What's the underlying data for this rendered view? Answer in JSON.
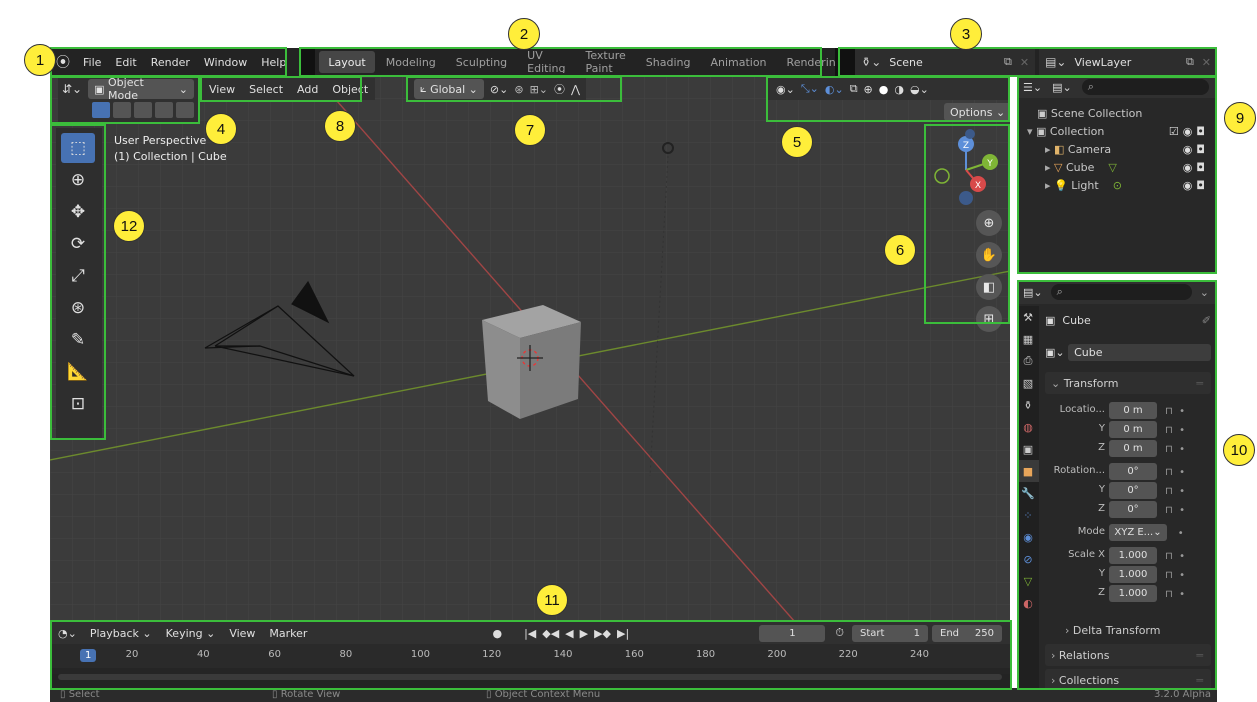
{
  "topbar": {
    "menus": [
      "File",
      "Edit",
      "Render",
      "Window",
      "Help"
    ],
    "workspaces": [
      "Layout",
      "Modeling",
      "Sculpting",
      "UV Editing",
      "Texture Paint",
      "Shading",
      "Animation",
      "Rendering"
    ],
    "active_workspace": "Layout",
    "scene": "Scene",
    "view_layer": "ViewLayer"
  },
  "viewport_header": {
    "mode": "Object Mode",
    "menus": [
      "View",
      "Select",
      "Add",
      "Object"
    ],
    "orientation": "Global",
    "options": "Options"
  },
  "viewport": {
    "view_name": "User Perspective",
    "context": "(1) Collection | Cube",
    "gizmo": {
      "z": "Z",
      "y": "Y",
      "x": "X"
    }
  },
  "outliner": {
    "root": "Scene Collection",
    "collection": "Collection",
    "items": [
      {
        "name": "Camera",
        "icon": "camera-icon",
        "color": "#e0b36a"
      },
      {
        "name": "Cube",
        "icon": "mesh-icon",
        "color": "#e8a55a"
      },
      {
        "name": "Light",
        "icon": "light-icon",
        "color": "#e0b36a"
      }
    ]
  },
  "properties": {
    "object_name": "Cube",
    "mesh_name": "Cube",
    "transform_label": "Transform",
    "location_label": "Locatio...",
    "rotation_label": "Rotation...",
    "axis_y": "Y",
    "axis_z": "Z",
    "location": [
      "0 m",
      "0 m",
      "0 m"
    ],
    "rotation": [
      "0°",
      "0°",
      "0°"
    ],
    "mode_label": "Mode",
    "mode_value": "XYZ E...",
    "scale_x_label": "Scale X",
    "scale": [
      "1.000",
      "1.000",
      "1.000"
    ],
    "delta_transform": "Delta Transform",
    "relations": "Relations",
    "collections": "Collections"
  },
  "timeline": {
    "menus": [
      "Playback",
      "Keying",
      "View",
      "Marker"
    ],
    "current_frame": "1",
    "start_label": "Start",
    "start": "1",
    "end_label": "End",
    "end": "250",
    "ruler": [
      "1",
      "20",
      "40",
      "60",
      "80",
      "100",
      "120",
      "140",
      "160",
      "180",
      "200",
      "220",
      "240"
    ]
  },
  "statusbar": {
    "items": [
      "Select",
      "Rotate View",
      "Object Context Menu"
    ],
    "version": "3.2.0 Alpha"
  },
  "badges": [
    "1",
    "2",
    "3",
    "4",
    "5",
    "6",
    "7",
    "8",
    "9",
    "10",
    "11",
    "12"
  ],
  "colors": {
    "accent": "#4772b3",
    "outline": "#3bbd3b",
    "badge": "#ffee3a",
    "axis_x": "#d84a4a",
    "axis_y": "#7fb536",
    "gizmo_z": "#5d8fd9"
  }
}
